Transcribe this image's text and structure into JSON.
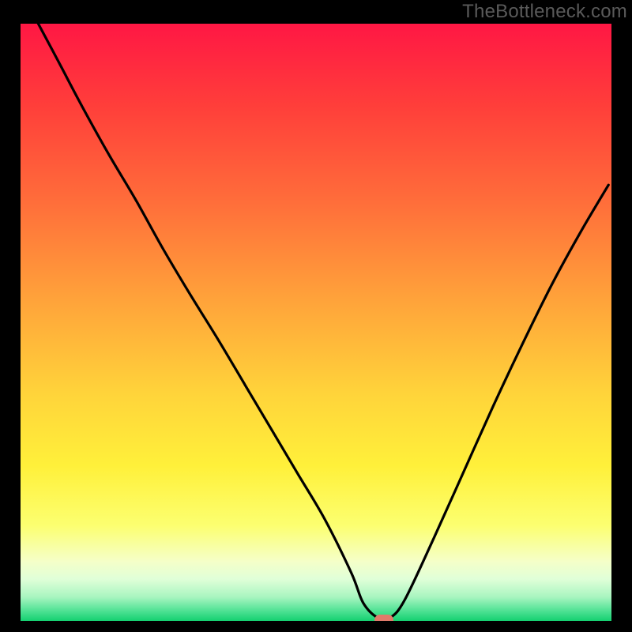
{
  "watermark": "TheBottleneck.com",
  "chart_data": {
    "type": "line",
    "title": "",
    "xlabel": "",
    "ylabel": "",
    "xlim": [
      0,
      100
    ],
    "ylim": [
      0,
      100
    ],
    "x": [
      3.0,
      6.5,
      10.5,
      15.0,
      19.5,
      24.0,
      28.5,
      33.5,
      38.0,
      42.5,
      47.0,
      51.5,
      56.0,
      58.0,
      60.5,
      62.5,
      65.0,
      70.0,
      75.0,
      80.0,
      85.0,
      90.0,
      95.0,
      99.5
    ],
    "values": [
      100.0,
      93.5,
      86.0,
      78.0,
      70.5,
      62.5,
      55.0,
      47.0,
      39.5,
      32.0,
      24.5,
      17.0,
      8.0,
      3.0,
      0.5,
      0.5,
      3.5,
      14.0,
      25.0,
      36.0,
      46.5,
      56.5,
      65.5,
      73.0
    ],
    "marker": {
      "x": 61.5,
      "y": 0.0,
      "color": "#e07a6a"
    },
    "gradient_stops": [
      {
        "offset": 0.0,
        "color": "#ff1744"
      },
      {
        "offset": 0.14,
        "color": "#ff3f3a"
      },
      {
        "offset": 0.3,
        "color": "#ff6e3a"
      },
      {
        "offset": 0.46,
        "color": "#ffa23a"
      },
      {
        "offset": 0.62,
        "color": "#ffd43a"
      },
      {
        "offset": 0.74,
        "color": "#fff03a"
      },
      {
        "offset": 0.84,
        "color": "#fcff70"
      },
      {
        "offset": 0.9,
        "color": "#f5ffc8"
      },
      {
        "offset": 0.93,
        "color": "#e0ffd8"
      },
      {
        "offset": 0.96,
        "color": "#a8f5c0"
      },
      {
        "offset": 0.985,
        "color": "#48e090"
      },
      {
        "offset": 1.0,
        "color": "#15d070"
      }
    ],
    "frame_color": "#000000",
    "frame_thickness_top": 30,
    "frame_thickness_sides": 26,
    "frame_thickness_bottom": 14,
    "line_color": "#000000",
    "line_width": 3.2
  }
}
